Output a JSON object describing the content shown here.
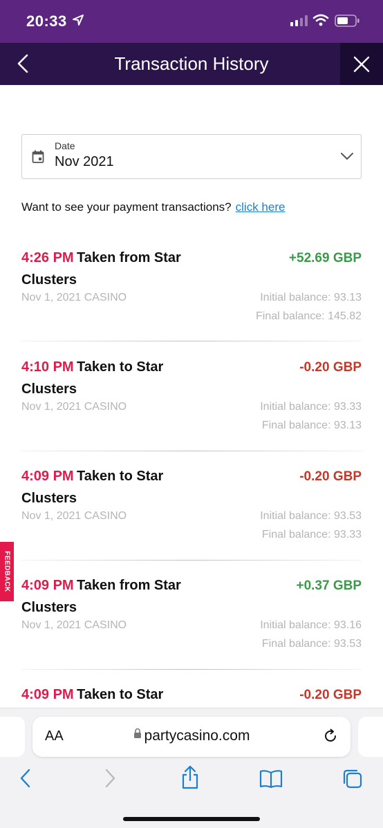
{
  "status_bar": {
    "time": "20:33",
    "icons": [
      "location-arrow-icon",
      "cellular-signal-icon",
      "wifi-icon",
      "battery-icon"
    ]
  },
  "header": {
    "title": "Transaction History",
    "back_icon": "chevron-left-icon",
    "close_icon": "close-icon"
  },
  "date_filter": {
    "label": "Date",
    "value": "Nov 2021"
  },
  "payment_prompt": {
    "text": "Want to see your payment transactions?",
    "link": "click here"
  },
  "transactions": [
    {
      "time": "4:26 PM",
      "description": "Taken from Star Clusters",
      "amount": "+52.69 GBP",
      "direction": "positive",
      "meta": "Nov 1, 2021 CASINO",
      "initial_balance": "Initial balance: 93.13",
      "final_balance": "Final balance: 145.82"
    },
    {
      "time": "4:10 PM",
      "description": "Taken to Star Clusters",
      "amount": "-0.20 GBP",
      "direction": "negative",
      "meta": "Nov 1, 2021 CASINO",
      "initial_balance": "Initial balance: 93.33",
      "final_balance": "Final balance: 93.13"
    },
    {
      "time": "4:09 PM",
      "description": "Taken to Star Clusters",
      "amount": "-0.20 GBP",
      "direction": "negative",
      "meta": "Nov 1, 2021 CASINO",
      "initial_balance": "Initial balance: 93.53",
      "final_balance": "Final balance: 93.33"
    },
    {
      "time": "4:09 PM",
      "description": "Taken from Star Clusters",
      "amount": "+0.37 GBP",
      "direction": "positive",
      "meta": "Nov 1, 2021 CASINO",
      "initial_balance": "Initial balance: 93.16",
      "final_balance": "Final balance: 93.53"
    },
    {
      "time": "4:09 PM",
      "description": "Taken to Star",
      "amount": "-0.20 GBP",
      "direction": "negative"
    }
  ],
  "feedback": {
    "label": "FEEDBACK"
  },
  "browser": {
    "text_size_label": "AA",
    "url": "partycasino.com",
    "toolbar_icons": [
      "back-icon",
      "forward-icon",
      "share-icon",
      "bookmarks-icon",
      "tabs-icon"
    ]
  },
  "colors": {
    "status_bar": "#5b2580",
    "header": "#2a1449",
    "close_button": "#1a0b33",
    "time_accent": "#e3194b",
    "positive_amount": "#3a9a4a",
    "negative_amount": "#c0392b",
    "link": "#1b7fd0",
    "safari_blue": "#1b7fd0"
  }
}
